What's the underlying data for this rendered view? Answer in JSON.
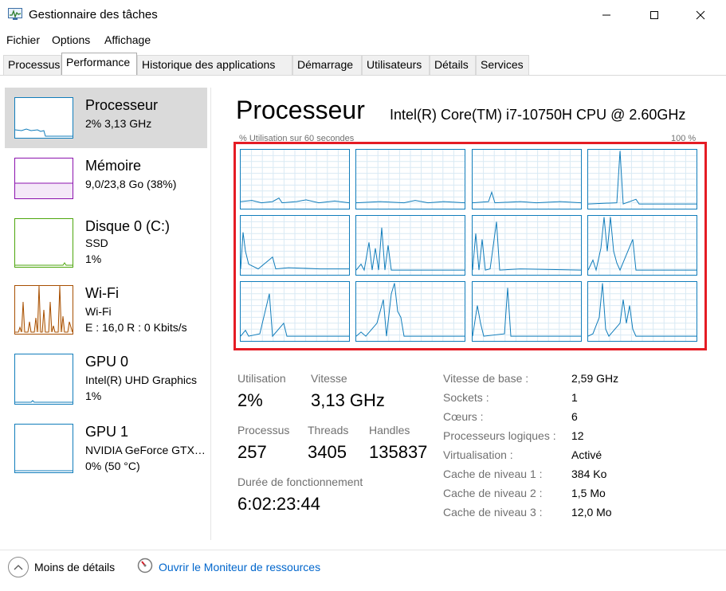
{
  "window": {
    "title": "Gestionnaire des tâches",
    "minimize_glyph": "—",
    "maximize_glyph": "☐",
    "close_glyph": "✕"
  },
  "menu": [
    "Fichier",
    "Options",
    "Affichage"
  ],
  "tabs": [
    {
      "label": "Processus",
      "active": false
    },
    {
      "label": "Performance",
      "active": true
    },
    {
      "label": "Historique des applications",
      "active": false
    },
    {
      "label": "Démarrage",
      "active": false
    },
    {
      "label": "Utilisateurs",
      "active": false
    },
    {
      "label": "Détails",
      "active": false
    },
    {
      "label": "Services",
      "active": false
    }
  ],
  "sidebar": {
    "items": [
      {
        "name": "Processeur",
        "lines": [
          "2% 3,13 GHz"
        ],
        "color": "#117dbb",
        "active": true
      },
      {
        "name": "Mémoire",
        "lines": [
          "9,0/23,8 Go (38%)"
        ],
        "color": "#8b12ae",
        "active": false
      },
      {
        "name": "Disque 0 (C:)",
        "lines": [
          "SSD",
          "1%"
        ],
        "color": "#4da60c",
        "active": false
      },
      {
        "name": "Wi-Fi",
        "lines": [
          "Wi-Fi",
          "E : 16,0 R : 0 Kbits/s"
        ],
        "color": "#a74f01",
        "active": false
      },
      {
        "name": "GPU 0",
        "lines": [
          "Intel(R) UHD Graphics",
          "1%"
        ],
        "color": "#117dbb",
        "active": false
      },
      {
        "name": "GPU 1",
        "lines": [
          "NVIDIA GeForce GTX…",
          "0% (50 °C)"
        ],
        "color": "#117dbb",
        "active": false
      }
    ]
  },
  "main": {
    "title": "Processeur",
    "cpu_name": "Intel(R) Core(TM) i7-10750H CPU @ 2.60GHz",
    "graph_caption_left": "% Utilisation sur 60 secondes",
    "graph_caption_right": "100 %",
    "graph_color": "#117dbb",
    "highlight_color": "#e51c24",
    "stats": {
      "utilisation_label": "Utilisation",
      "utilisation_value": "2%",
      "vitesse_label": "Vitesse",
      "vitesse_value": "3,13 GHz",
      "processus_label": "Processus",
      "processus_value": "257",
      "threads_label": "Threads",
      "threads_value": "3405",
      "handles_label": "Handles",
      "handles_value": "135837",
      "uptime_label": "Durée de fonctionnement",
      "uptime_value": "6:02:23:44"
    },
    "info": [
      {
        "label": "Vitesse de base :",
        "value": "2,59 GHz"
      },
      {
        "label": "Sockets :",
        "value": "1"
      },
      {
        "label": "Cœurs :",
        "value": "6"
      },
      {
        "label": "Processeurs logiques :",
        "value": "12"
      },
      {
        "label": "Virtualisation :",
        "value": "Activé"
      },
      {
        "label": "Cache de niveau 1 :",
        "value": "384 Ko"
      },
      {
        "label": "Cache de niveau 2 :",
        "value": "1,5 Mo"
      },
      {
        "label": "Cache de niveau 3 :",
        "value": "12,0 Mo"
      }
    ]
  },
  "footer": {
    "less_details": "Moins de détails",
    "resource_monitor": "Ouvrir le Moniteur de ressources"
  }
}
